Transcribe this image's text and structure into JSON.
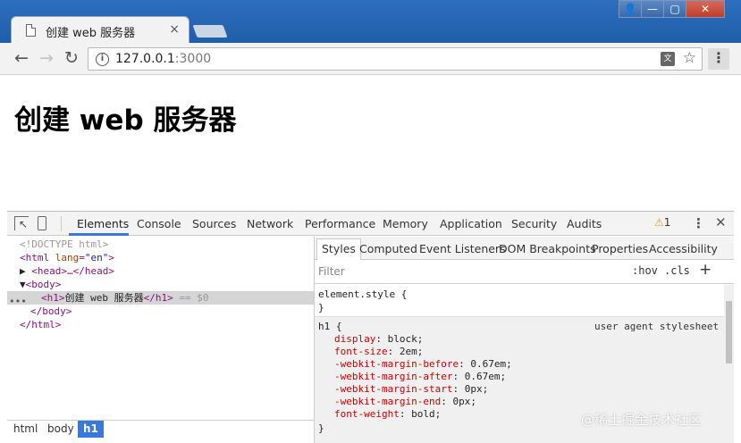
{
  "browser": {
    "tab_title": "创建 web 服务器",
    "tab_close": "×",
    "url_host": "127.0.0.1",
    "url_port": ":3000",
    "window_controls": [
      "👤",
      "—",
      "▢",
      "✕"
    ]
  },
  "page": {
    "heading": "创建 web 服务器"
  },
  "devtools": {
    "tabs": [
      "Elements",
      "Console",
      "Sources",
      "Network",
      "Performance",
      "Memory",
      "Application",
      "Security",
      "Audits"
    ],
    "warning_count": "1",
    "dom": {
      "doctype": "<!DOCTYPE html>",
      "html_open": "<html",
      "lang_attr": "lang",
      "lang_val": "\"en\"",
      "head": "<head>…</head>",
      "body_open": "<body>",
      "h1_open": "<h1>",
      "h1_text": "创建 web 服务器",
      "h1_close": "</h1>",
      "h1_eq": "== $0",
      "body_close": "</body>",
      "html_close": "</html>"
    },
    "breadcrumbs": [
      "html",
      "body",
      "h1"
    ],
    "styles_tabs": [
      "Styles",
      "Computed",
      "Event Listeners",
      "DOM Breakpoints",
      "Properties",
      "Accessibility"
    ],
    "filter_placeholder": "Filter",
    "hov": ":hov",
    "cls": ".cls",
    "element_style": "element.style {",
    "brace_close": "}",
    "h1_selector": "h1 {",
    "ua_label": "user agent stylesheet",
    "h1_props": [
      {
        "name": "display",
        "value": "block;"
      },
      {
        "name": "font-size",
        "value": "2em;"
      },
      {
        "name": "-webkit-margin-before",
        "value": "0.67em;"
      },
      {
        "name": "-webkit-margin-after",
        "value": "0.67em;"
      },
      {
        "name": "-webkit-margin-start",
        "value": "0px;"
      },
      {
        "name": "-webkit-margin-end",
        "value": "0px;"
      },
      {
        "name": "font-weight",
        "value": "bold;"
      }
    ]
  },
  "watermark": "@稀土掘金技术社区"
}
